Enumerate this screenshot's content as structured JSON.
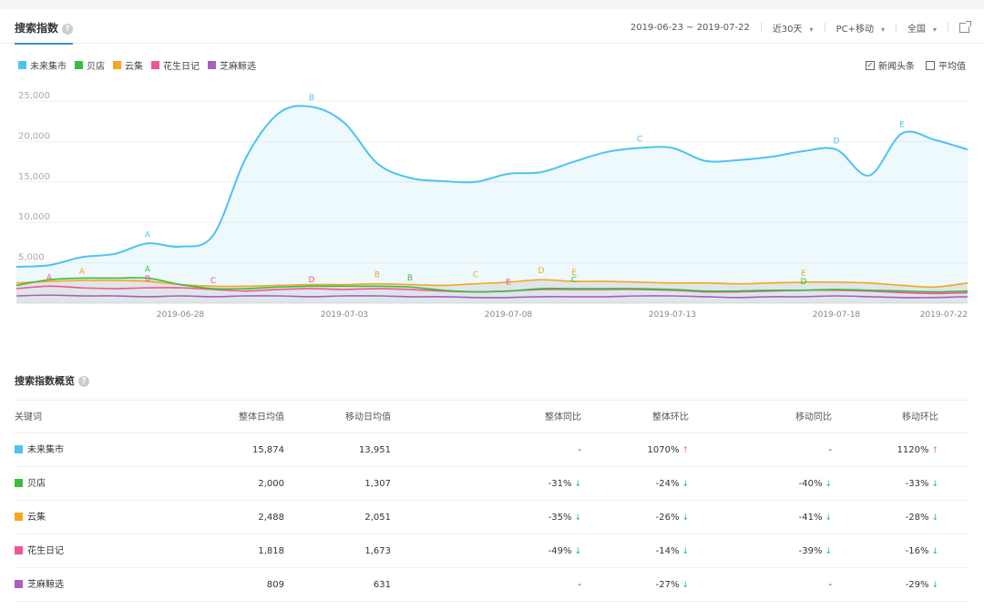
{
  "header": {
    "tab_label": "搜索指数",
    "help_icon": "question-icon",
    "date_range": "2019-06-23 ~ 2019-07-22",
    "period": "近30天",
    "device": "PC+移动",
    "region": "全国",
    "share_icon": "external-link-icon"
  },
  "legend": [
    {
      "name": "未来集市",
      "color": "#4ec3ef"
    },
    {
      "name": "贝店",
      "color": "#3cbc3c"
    },
    {
      "name": "云集",
      "color": "#f5a623"
    },
    {
      "name": "花生日记",
      "color": "#f1549a"
    },
    {
      "name": "芝麻鲸选",
      "color": "#a75fc1"
    }
  ],
  "options": {
    "news_label": "新闻头条",
    "news_checked": true,
    "news_check_glyph": "✓",
    "avg_label": "平均值",
    "avg_checked": false
  },
  "chart_data": {
    "type": "area",
    "title": "",
    "xlabel": "",
    "ylabel": "",
    "ylim": [
      0,
      25000
    ],
    "yticks": [
      "25,000",
      "20,000",
      "15,000",
      "10,000",
      "5,000"
    ],
    "ytick_values": [
      25000,
      20000,
      15000,
      10000,
      5000
    ],
    "xtick_labels": [
      "2019-06-28",
      "2019-07-03",
      "2019-07-08",
      "2019-07-13",
      "2019-07-18",
      "2019-07-22"
    ],
    "x": [
      "2019-06-23",
      "2019-06-24",
      "2019-06-25",
      "2019-06-26",
      "2019-06-27",
      "2019-06-28",
      "2019-06-29",
      "2019-06-30",
      "2019-07-01",
      "2019-07-02",
      "2019-07-03",
      "2019-07-04",
      "2019-07-05",
      "2019-07-06",
      "2019-07-07",
      "2019-07-08",
      "2019-07-09",
      "2019-07-10",
      "2019-07-11",
      "2019-07-12",
      "2019-07-13",
      "2019-07-14",
      "2019-07-15",
      "2019-07-16",
      "2019-07-17",
      "2019-07-18",
      "2019-07-19",
      "2019-07-20",
      "2019-07-21",
      "2019-07-22"
    ],
    "series": [
      {
        "name": "未来集市",
        "color": "#4ec3ef",
        "fill": true,
        "values": [
          4500,
          4700,
          5700,
          6100,
          7400,
          7000,
          8400,
          18000,
          23500,
          24300,
          22300,
          17300,
          15500,
          15100,
          15000,
          16000,
          16200,
          17500,
          18700,
          19200,
          19200,
          17600,
          17700,
          18100,
          18800,
          19000,
          15800,
          21000,
          20200,
          19000
        ]
      },
      {
        "name": "贝店",
        "color": "#3cbc3c",
        "fill": false,
        "values": [
          2200,
          2900,
          3100,
          3100,
          3100,
          2300,
          1800,
          1800,
          2000,
          2100,
          2100,
          2100,
          2000,
          1600,
          1400,
          1500,
          1800,
          1800,
          1800,
          1800,
          1700,
          1500,
          1500,
          1600,
          1600,
          1700,
          1600,
          1500,
          1400,
          1500
        ]
      },
      {
        "name": "云集",
        "color": "#f5a623",
        "fill": false,
        "values": [
          2500,
          2700,
          2800,
          2800,
          2700,
          2300,
          2100,
          2100,
          2200,
          2300,
          2300,
          2400,
          2300,
          2200,
          2400,
          2600,
          2900,
          2700,
          2700,
          2600,
          2500,
          2500,
          2400,
          2500,
          2600,
          2600,
          2500,
          2200,
          2000,
          2500
        ]
      },
      {
        "name": "花生日记",
        "color": "#f1549a",
        "fill": false,
        "values": [
          1800,
          2100,
          1900,
          1800,
          1900,
          1900,
          1700,
          1500,
          1700,
          1800,
          1700,
          1800,
          1700,
          1500,
          1400,
          1500,
          1700,
          1700,
          1700,
          1700,
          1600,
          1400,
          1400,
          1500,
          1600,
          1600,
          1500,
          1300,
          1200,
          1300
        ]
      },
      {
        "name": "芝麻鲸选",
        "color": "#a75fc1",
        "fill": false,
        "values": [
          900,
          1000,
          900,
          900,
          800,
          900,
          800,
          900,
          900,
          800,
          900,
          900,
          800,
          800,
          700,
          700,
          800,
          800,
          800,
          900,
          900,
          800,
          700,
          800,
          800,
          900,
          800,
          700,
          700,
          800
        ]
      }
    ],
    "annotations": [
      {
        "label": "A",
        "series": 0,
        "x_index": 4
      },
      {
        "label": "B",
        "series": 0,
        "x_index": 9
      },
      {
        "label": "C",
        "series": 0,
        "x_index": 19
      },
      {
        "label": "D",
        "series": 0,
        "x_index": 25
      },
      {
        "label": "E",
        "series": 0,
        "x_index": 27
      },
      {
        "label": "A",
        "series": 1,
        "x_index": 4
      },
      {
        "label": "B",
        "series": 1,
        "x_index": 12
      },
      {
        "label": "C",
        "series": 1,
        "x_index": 17
      },
      {
        "label": "D",
        "series": 1,
        "x_index": 24
      },
      {
        "label": "A",
        "series": 2,
        "x_index": 2
      },
      {
        "label": "B",
        "series": 2,
        "x_index": 11
      },
      {
        "label": "C",
        "series": 2,
        "x_index": 14
      },
      {
        "label": "D",
        "series": 2,
        "x_index": 16
      },
      {
        "label": "E",
        "series": 2,
        "x_index": 17
      },
      {
        "label": "E",
        "series": 2,
        "x_index": 24
      },
      {
        "label": "A",
        "series": 3,
        "x_index": 1
      },
      {
        "label": "B",
        "series": 3,
        "x_index": 4
      },
      {
        "label": "C",
        "series": 3,
        "x_index": 6
      },
      {
        "label": "D",
        "series": 3,
        "x_index": 9
      },
      {
        "label": "E",
        "series": 3,
        "x_index": 15
      }
    ],
    "grid": true,
    "legend_position": "top-left"
  },
  "overview": {
    "title": "搜索指数概览",
    "columns": [
      "关键词",
      "整体日均值",
      "移动日均值",
      "整体同比",
      "整体环比",
      "移动同比",
      "移动环比"
    ],
    "rows": [
      {
        "name": "未来集市",
        "color": "#4ec3ef",
        "overall_avg": "15,874",
        "mobile_avg": "13,951",
        "overall_yoy": "-",
        "overall_yoy_dir": "",
        "overall_mom": "1070%",
        "overall_mom_dir": "up",
        "mobile_yoy": "-",
        "mobile_yoy_dir": "",
        "mobile_mom": "1120%",
        "mobile_mom_dir": "up"
      },
      {
        "name": "贝店",
        "color": "#3cbc3c",
        "overall_avg": "2,000",
        "mobile_avg": "1,307",
        "overall_yoy": "-31%",
        "overall_yoy_dir": "down",
        "overall_mom": "-24%",
        "overall_mom_dir": "down",
        "mobile_yoy": "-40%",
        "mobile_yoy_dir": "down",
        "mobile_mom": "-33%",
        "mobile_mom_dir": "down"
      },
      {
        "name": "云集",
        "color": "#f5a623",
        "overall_avg": "2,488",
        "mobile_avg": "2,051",
        "overall_yoy": "-35%",
        "overall_yoy_dir": "down",
        "overall_mom": "-26%",
        "overall_mom_dir": "down",
        "mobile_yoy": "-41%",
        "mobile_yoy_dir": "down",
        "mobile_mom": "-28%",
        "mobile_mom_dir": "down"
      },
      {
        "name": "花生日记",
        "color": "#f1549a",
        "overall_avg": "1,818",
        "mobile_avg": "1,673",
        "overall_yoy": "-49%",
        "overall_yoy_dir": "down",
        "overall_mom": "-14%",
        "overall_mom_dir": "down",
        "mobile_yoy": "-39%",
        "mobile_yoy_dir": "down",
        "mobile_mom": "-16%",
        "mobile_mom_dir": "down"
      },
      {
        "name": "芝麻鲸选",
        "color": "#a75fc1",
        "overall_avg": "809",
        "mobile_avg": "631",
        "overall_yoy": "-",
        "overall_yoy_dir": "",
        "overall_mom": "-27%",
        "overall_mom_dir": "down",
        "mobile_yoy": "-",
        "mobile_yoy_dir": "",
        "mobile_mom": "-29%",
        "mobile_mom_dir": "down"
      }
    ]
  }
}
